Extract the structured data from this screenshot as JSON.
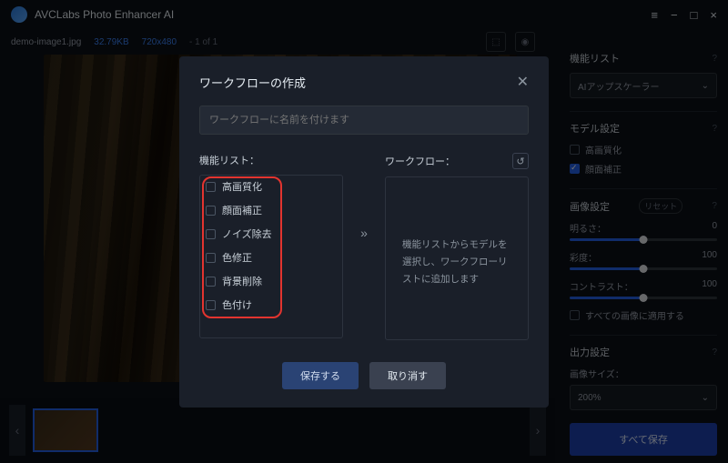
{
  "app": {
    "title": "AVCLabs Photo Enhancer AI"
  },
  "file": {
    "name": "demo-image1.jpg",
    "size": "32.79KB",
    "dim": "720x480",
    "page": "- 1 of 1"
  },
  "side": {
    "feature_list": "機能リスト",
    "dropdown": "AIアップスケーラー",
    "model_settings": "モデル設定",
    "upscale": "高画質化",
    "face": "顔面補正",
    "image_settings": "画像設定",
    "reset": "リセット",
    "brightness": "明るさ：",
    "saturation": "彩度：",
    "contrast": "コントラスト：",
    "val0": "0",
    "val100": "100",
    "apply_all": "すべての画像に適用する",
    "output_settings": "出力設定",
    "image_size": "画像サイズ：",
    "pct": "200%",
    "save_all": "すべて保存"
  },
  "modal": {
    "title": "ワークフローの作成",
    "placeholder": "ワークフローに名前を付けます",
    "list_head": "機能リスト：",
    "wf_head": "ワークフロー：",
    "features": [
      "高画質化",
      "顔面補正",
      "ノイズ除去",
      "色修正",
      "背景削除",
      "色付け"
    ],
    "empty": "機能リストからモデルを選択し、ワークフローリストに追加します",
    "save": "保存する",
    "cancel": "取り消す"
  }
}
